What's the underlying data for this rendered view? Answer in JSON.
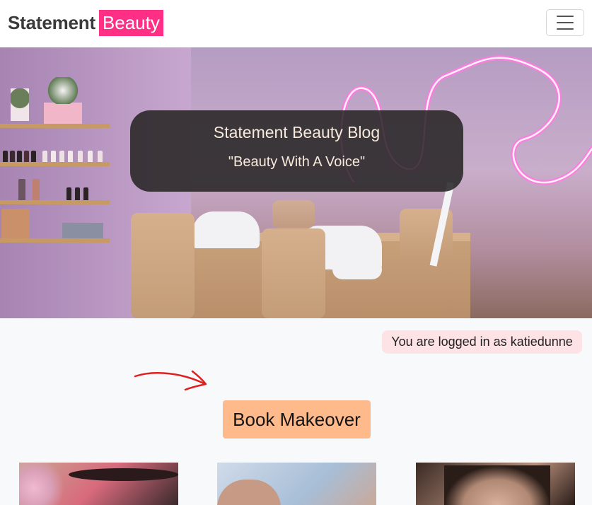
{
  "navbar": {
    "brand_main": "Statement",
    "brand_accent": "Beauty",
    "toggler_icon": "hamburger-menu-icon"
  },
  "hero": {
    "title": "Statement Beauty Blog",
    "subtitle": "\"Beauty With A Voice\""
  },
  "login_status": "You are logged in as katiedunne",
  "book_button_label": "Book Makeover",
  "colors": {
    "brand_accent": "#ff2f86",
    "button_bg": "#ffba8c",
    "badge_bg": "#fde3e6",
    "arrow": "#e02020"
  }
}
